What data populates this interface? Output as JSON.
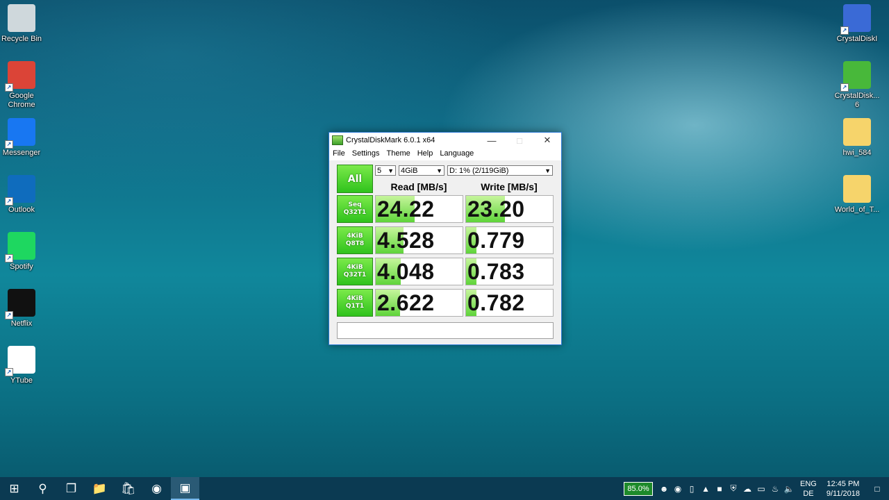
{
  "desktop": {
    "left_icons": [
      {
        "label": "Recycle Bin",
        "icon": "recycle-bin-icon",
        "color": "#cfd8dc"
      },
      {
        "label": "Google Chrome",
        "icon": "chrome-icon",
        "color": "#db4437"
      },
      {
        "label": "Messenger",
        "icon": "messenger-icon",
        "color": "#1877f2"
      },
      {
        "label": "Outlook",
        "icon": "outlook-icon",
        "color": "#0f6cbd"
      },
      {
        "label": "Spotify",
        "icon": "spotify-icon",
        "color": "#1ed760"
      },
      {
        "label": "Netflix",
        "icon": "netflix-icon",
        "color": "#111111"
      },
      {
        "label": "YTube",
        "icon": "file-icon",
        "color": "#ffffff"
      }
    ],
    "right_icons": [
      {
        "label": "CrystalDiskI",
        "icon": "crystaldiskinfo-icon",
        "color": "#3a6ad6"
      },
      {
        "label": "CrystalDisk... 6",
        "icon": "crystaldiskmark-icon",
        "color": "#48b83a"
      },
      {
        "label": "hwi_584",
        "icon": "folder-icon",
        "color": "#f6d46b"
      },
      {
        "label": "World_of_T...",
        "icon": "folder-icon",
        "color": "#f6d46b"
      }
    ]
  },
  "window": {
    "title": "CrystalDiskMark 6.0.1 x64",
    "menu": [
      "File",
      "Settings",
      "Theme",
      "Help",
      "Language"
    ],
    "all_label": "All",
    "runs": "5",
    "size": "4GiB",
    "drive": "D: 1% (2/119GiB)",
    "read_header": "Read [MB/s]",
    "write_header": "Write [MB/s]",
    "tests": [
      {
        "line1": "Seq",
        "line2": "Q32T1",
        "read": "24.22",
        "write": "23.20",
        "read_fill": 0.45,
        "write_fill": 0.45
      },
      {
        "line1": "4KiB",
        "line2": "Q8T8",
        "read": "4.528",
        "write": "0.779",
        "read_fill": 0.32,
        "write_fill": 0.12
      },
      {
        "line1": "4KiB",
        "line2": "Q32T1",
        "read": "4.048",
        "write": "0.783",
        "read_fill": 0.29,
        "write_fill": 0.12
      },
      {
        "line1": "4KiB",
        "line2": "Q1T1",
        "read": "2.622",
        "write": "0.782",
        "read_fill": 0.28,
        "write_fill": 0.12
      }
    ],
    "comment": ""
  },
  "taskbar": {
    "pinned": [
      {
        "icon": "windows-start-icon",
        "glyph": "⊞"
      },
      {
        "icon": "search-icon",
        "glyph": "⚲"
      },
      {
        "icon": "task-view-icon",
        "glyph": "❐"
      },
      {
        "icon": "file-explorer-icon",
        "glyph": "📁"
      },
      {
        "icon": "store-icon",
        "glyph": "🛍"
      },
      {
        "icon": "chrome-icon",
        "glyph": "◉"
      },
      {
        "icon": "crystaldiskmark-icon",
        "glyph": "▣"
      }
    ],
    "meter": "85.0%",
    "lang_top": "ENG",
    "lang_bottom": "DE",
    "time": "12:45 PM",
    "date": "9/11/2018"
  }
}
